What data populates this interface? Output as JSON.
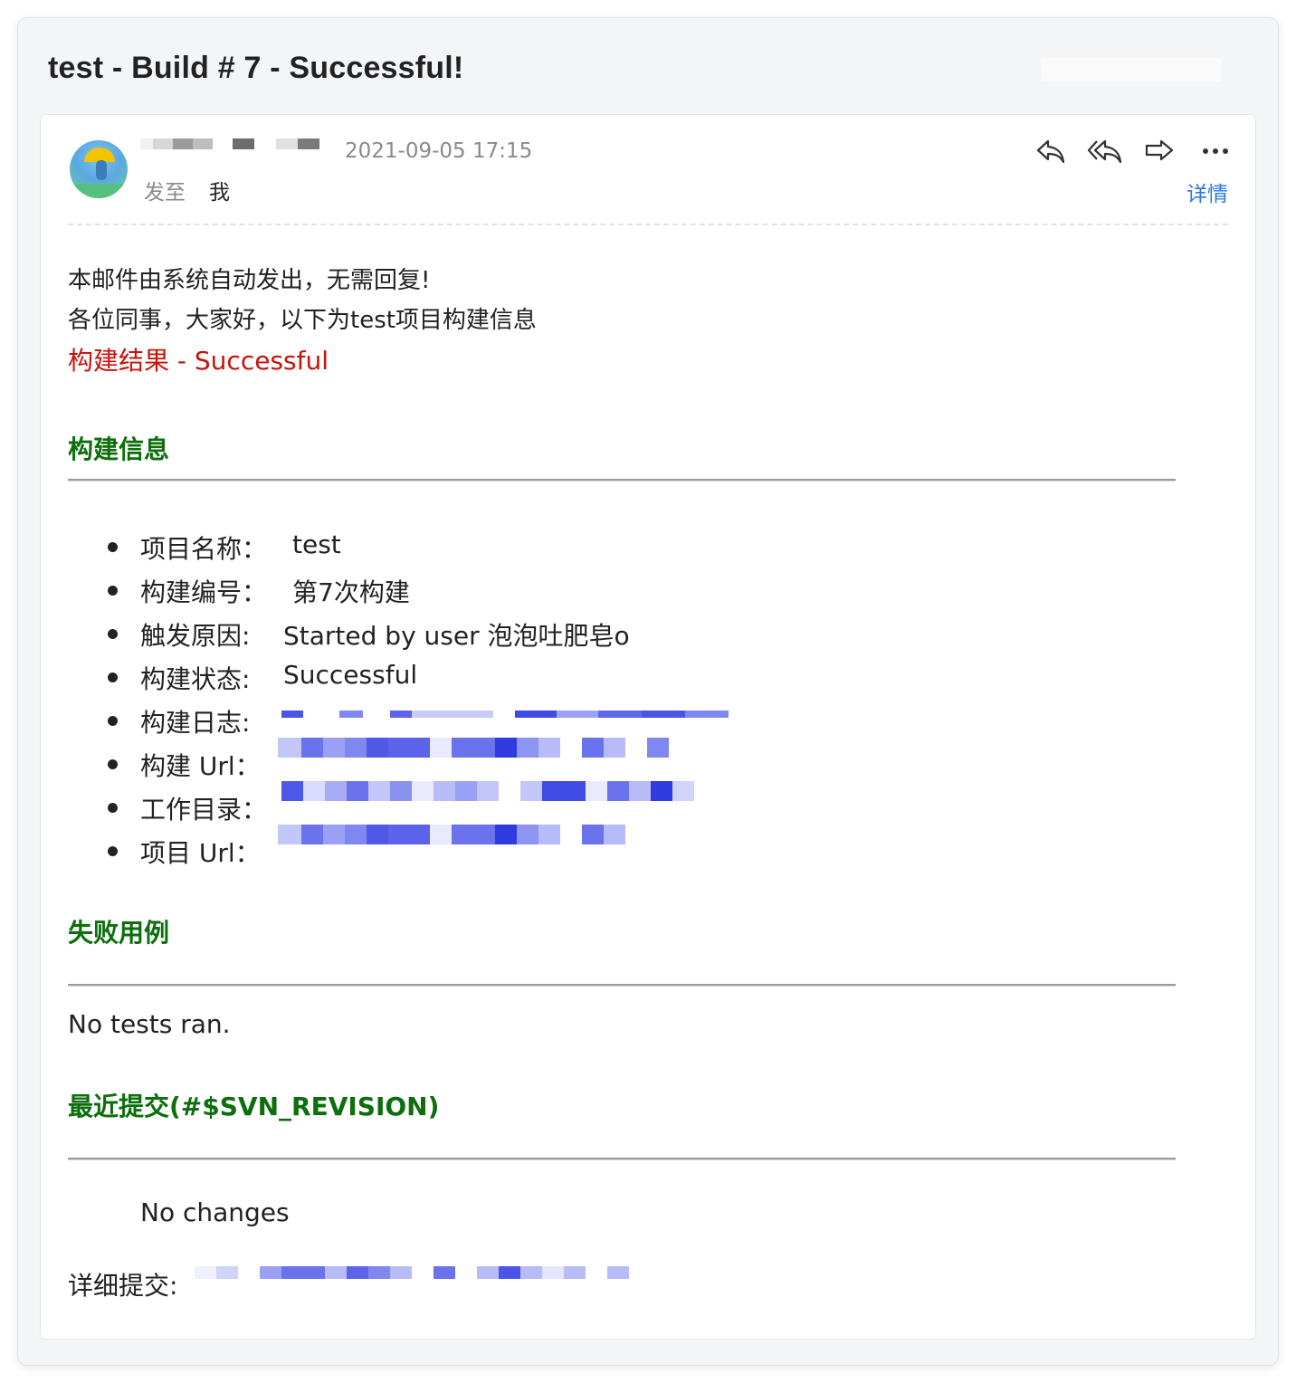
{
  "email": {
    "subject": "test - Build # 7 - Successful!",
    "date": "2021-09-05 17:15",
    "to_label": "发至",
    "to_value": "我",
    "details_link": "详情"
  },
  "toolbar": {
    "icons": [
      "reply-icon",
      "reply-all-icon",
      "forward-icon",
      "more-icon"
    ]
  },
  "body": {
    "line1": "本邮件由系统自动发出，无需回复!",
    "line2": "各位同事，大家好，以下为test项目构建信息",
    "result": "构建结果 - Successful",
    "section_build_info": "构建信息",
    "items": [
      {
        "label": "项目名称：",
        "value": "test"
      },
      {
        "label": "构建编号：",
        "value": "第7次构建"
      },
      {
        "label": "触发原因:",
        "value": "Started by user 泡泡吐肥皂o"
      },
      {
        "label": "构建状态:",
        "value": "Successful"
      },
      {
        "label": "构建日志:",
        "value": ""
      },
      {
        "label": "构建 Url：",
        "value": ""
      },
      {
        "label": "工作目录：",
        "value": ""
      },
      {
        "label": "项目 Url：",
        "value": ""
      }
    ],
    "section_failed_cases": "失败用例",
    "no_tests": "No tests ran.",
    "section_recent_commits": "最近提交(#$SVN_REVISION)",
    "no_changes": "No changes",
    "commit_details_label": "详细提交:"
  },
  "colors": {
    "result_red": "#c8120a",
    "section_green": "#0c6e0c",
    "link_blue": "#2a7ae2"
  }
}
